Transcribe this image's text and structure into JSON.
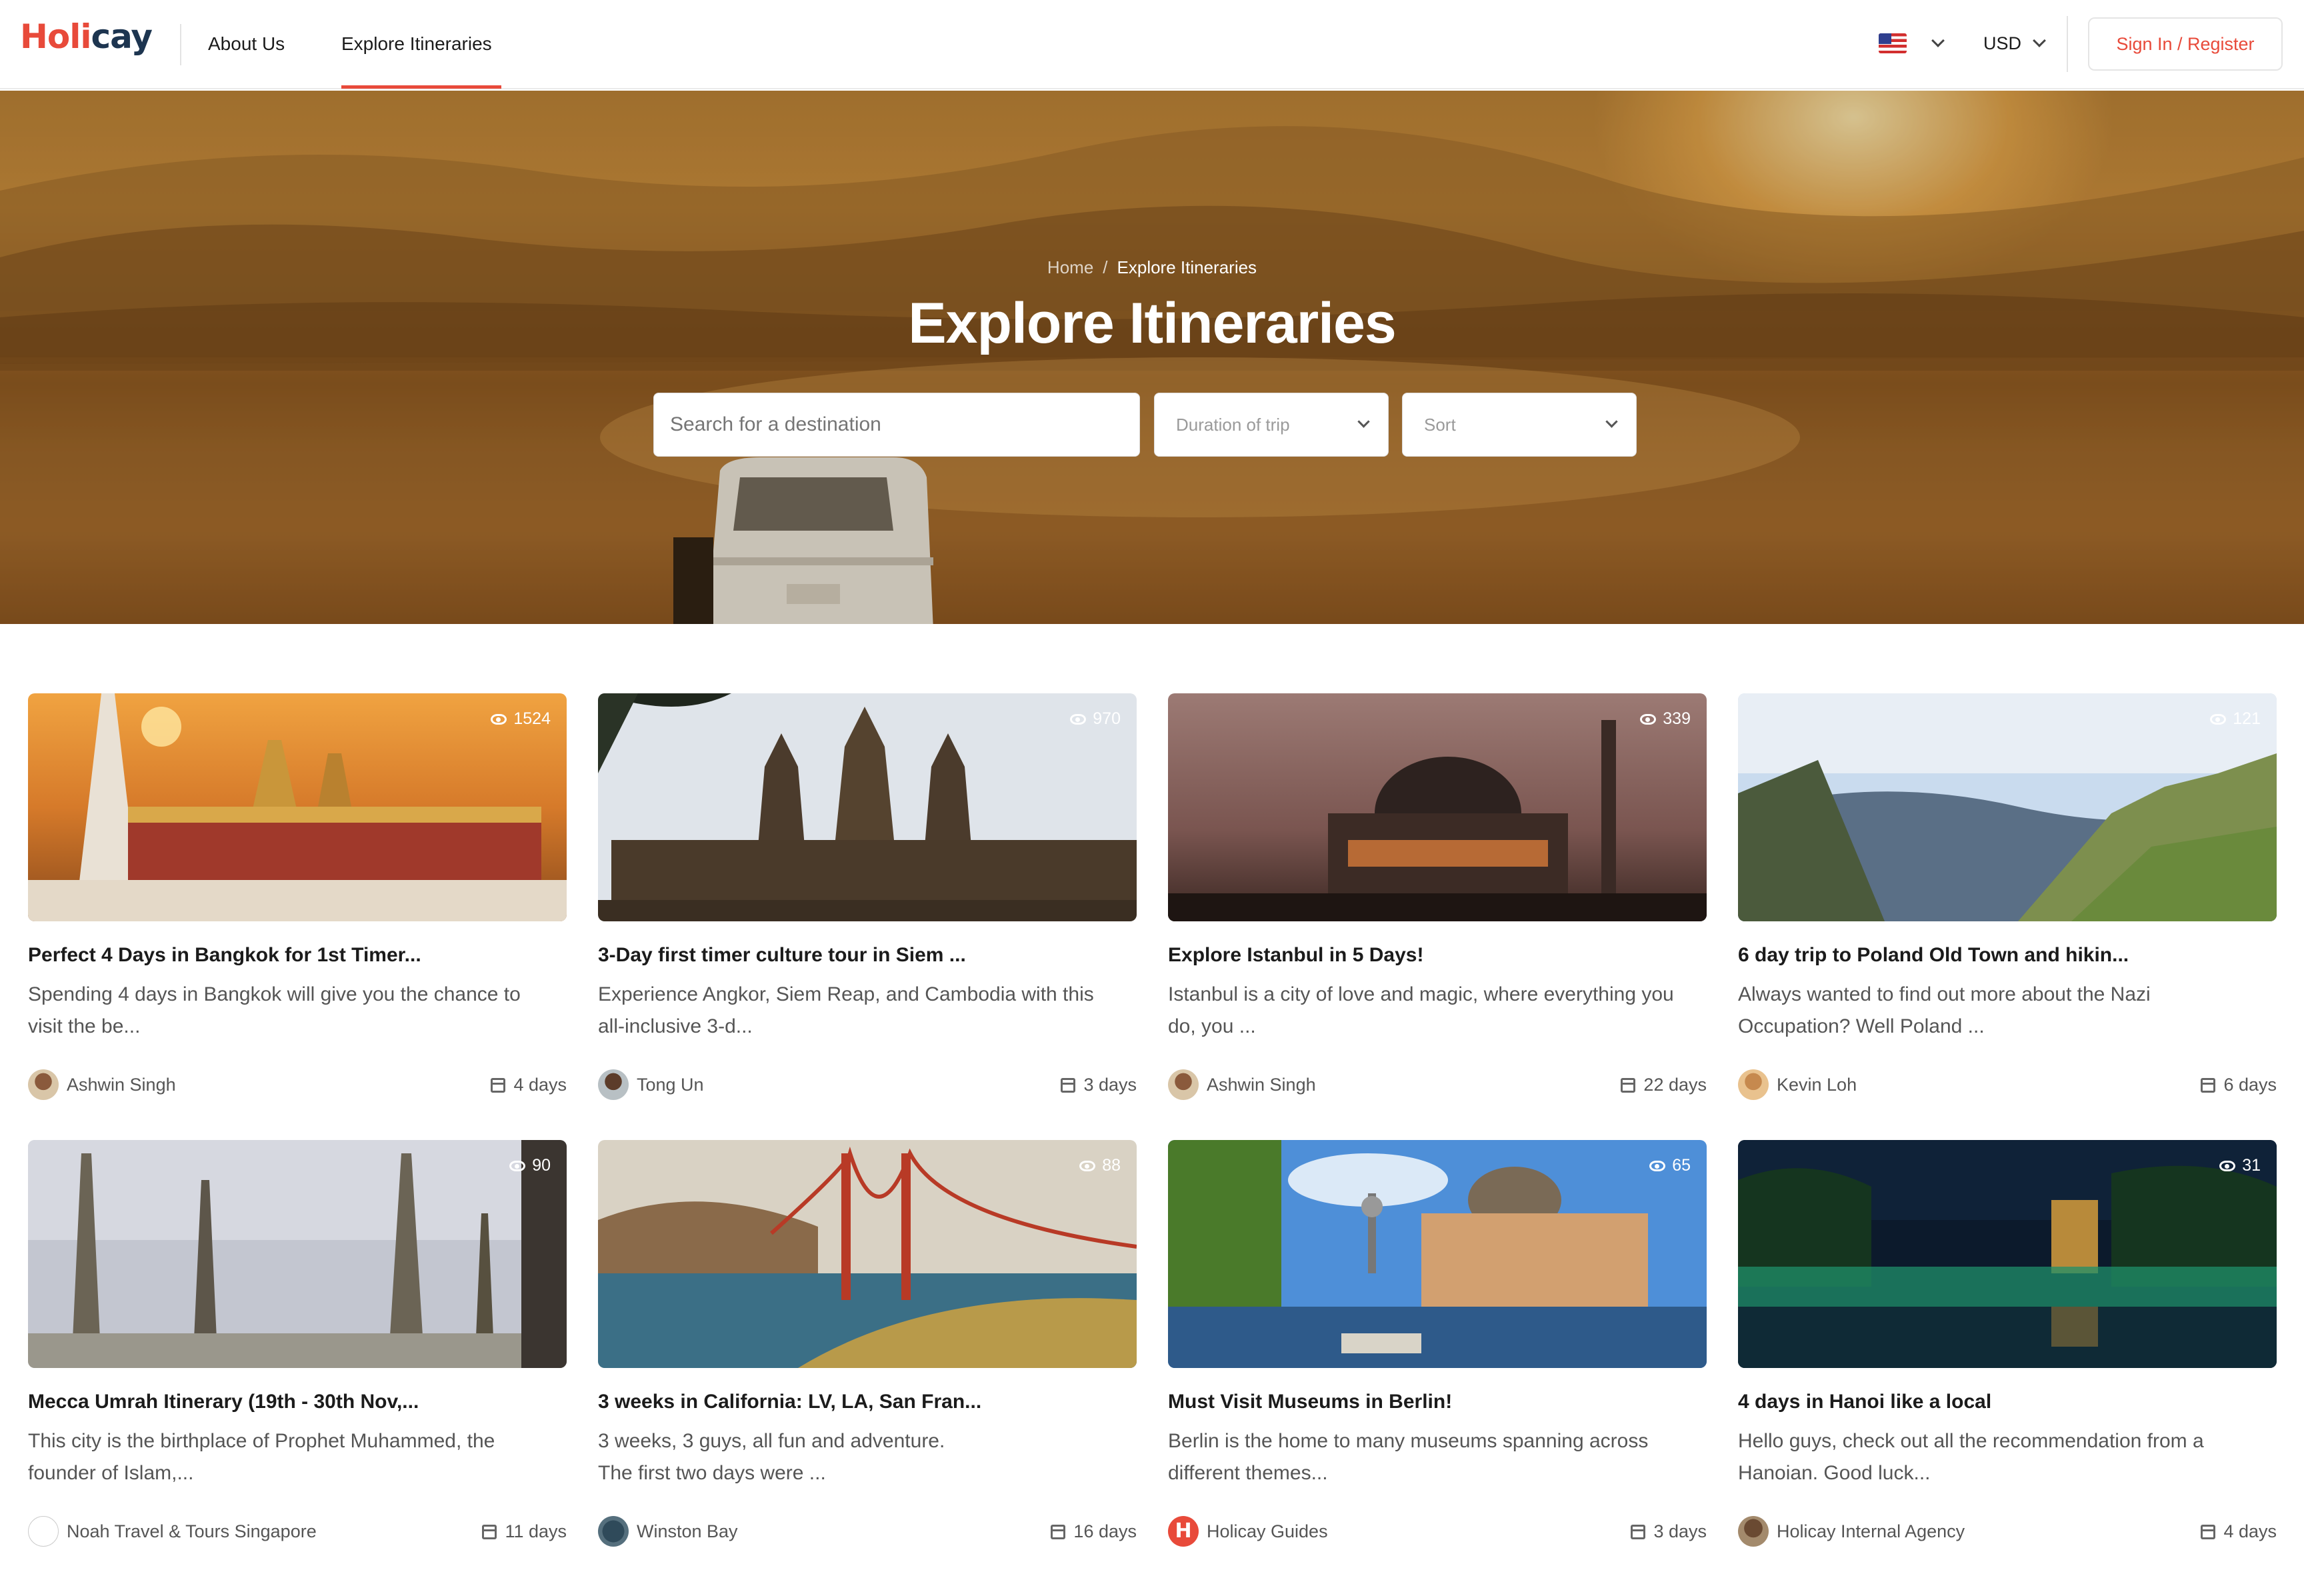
{
  "nav": {
    "logo_part1": "Holi",
    "logo_part2": "cay",
    "about": "About Us",
    "explore": "Explore Itineraries",
    "currency": "USD",
    "signin": "Sign In / Register"
  },
  "hero": {
    "breadcrumb_home": "Home",
    "breadcrumb_sep": "/",
    "breadcrumb_current": "Explore Itineraries",
    "title": "Explore Itineraries",
    "search_placeholder": "Search for a destination",
    "duration_placeholder": "Duration of trip",
    "sort_placeholder": "Sort"
  },
  "cards": [
    {
      "title": "Perfect 4 Days in Bangkok for 1st Timer...",
      "desc": "Spending 4 days in Bangkok will give you the chance to visit the be...",
      "author": "Ashwin Singh",
      "days": "4 days",
      "views": "1524"
    },
    {
      "title": "3-Day first timer culture tour in Siem ...",
      "desc": "Experience Angkor, Siem Reap, and Cambodia with this all-inclusive 3-d...",
      "author": "Tong Un",
      "days": "3 days",
      "views": "970"
    },
    {
      "title": "Explore Istanbul in 5 Days!",
      "desc": "Istanbul is a city of love and magic, where everything you do, you ...",
      "author": "Ashwin Singh",
      "days": "22 days",
      "views": "339"
    },
    {
      "title": "6 day trip to Poland Old Town and hikin...",
      "desc": "Always wanted to find out more about the Nazi Occupation? Well Poland ...",
      "author": "Kevin Loh",
      "days": "6 days",
      "views": "121"
    },
    {
      "title": "Mecca Umrah Itinerary (19th - 30th Nov,...",
      "desc": "This city is the birthplace of Prophet Muhammed, the founder of Islam,...",
      "author": "Noah Travel & Tours Singapore",
      "days": "11 days",
      "views": "90"
    },
    {
      "title": "3 weeks in California: LV, LA, San Fran...",
      "desc": "3 weeks, 3 guys, all fun and adventure.\nThe first two days were ...",
      "author": "Winston Bay",
      "days": "16 days",
      "views": "88"
    },
    {
      "title": "Must Visit Museums in Berlin!",
      "desc": "Berlin is the home to many museums spanning across different themes...",
      "author": "Holicay Guides",
      "days": "3 days",
      "views": "65"
    },
    {
      "title": "4 days in Hanoi like a local",
      "desc": "Hello guys, check out all the recommendation from a Hanoian. Good luck...",
      "author": "Holicay Internal Agency",
      "days": "4 days",
      "views": "31"
    }
  ],
  "colors": {
    "brand": "#e84a3a",
    "logo_dark": "#1d3550"
  }
}
